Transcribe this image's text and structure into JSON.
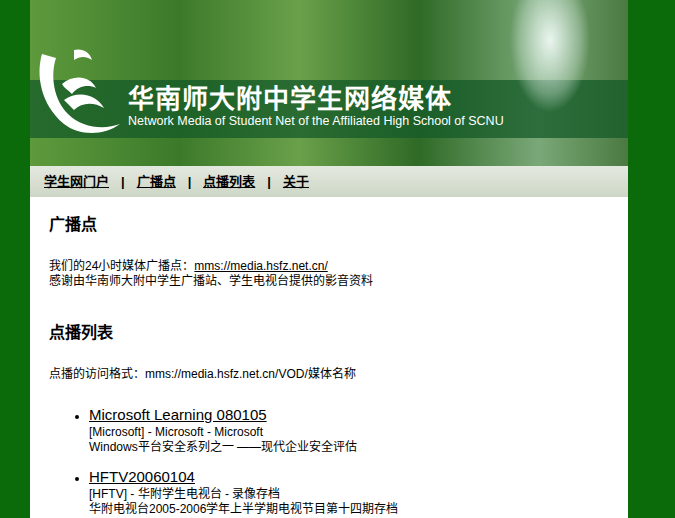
{
  "header": {
    "title": "华南师大附中学生网络媒体",
    "subtitle": "Network Media of Student Net of the Affiliated High School of SCNU"
  },
  "nav": {
    "separator": "|",
    "items": [
      {
        "label": "学生网门户"
      },
      {
        "label": "广播点"
      },
      {
        "label": "点播列表"
      },
      {
        "label": "关于"
      }
    ]
  },
  "broadcast": {
    "heading": "广播点",
    "intro": "我们的24小时媒体广播点：",
    "link": "mms://media.hsfz.net.cn/",
    "thanks": "感谢由华南师大附中学生广播站、学生电视台提供的影音资料"
  },
  "vod": {
    "heading": "点播列表",
    "format": "点播的访问格式：mms://media.hsfz.net.cn/VOD/媒体名称",
    "items": [
      {
        "title": "Microsoft Learning 080105",
        "meta": "[Microsoft] - Microsoft - Microsoft",
        "description": "Windows平台安全系列之一 ——现代企业安全评估"
      },
      {
        "title": "HFTV20060104",
        "meta": "[HFTV] - 华附学生电视台  - 录像存档",
        "description": "华附电视台2005-2006学年上半学期电视节目第十四期存档"
      }
    ]
  }
}
